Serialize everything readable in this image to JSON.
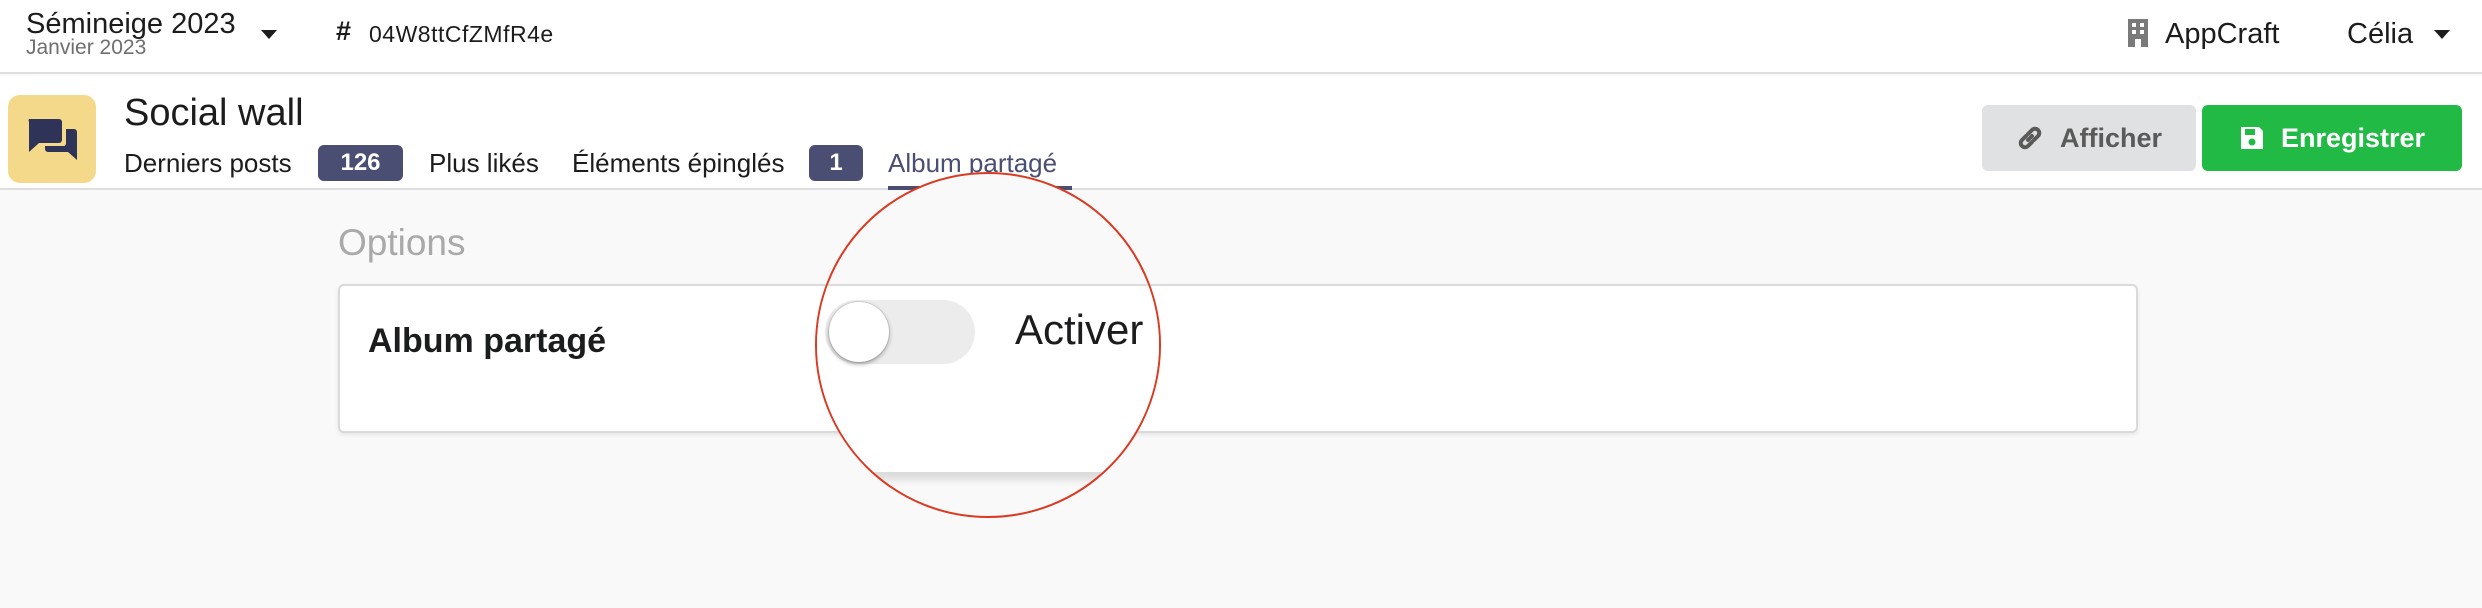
{
  "header": {
    "event_name": "Sémineige 2023",
    "event_subtitle": "Janvier 2023",
    "event_code": "04W8ttCfZMfR4e",
    "organization": "AppCraft",
    "user_name": "Célia"
  },
  "module": {
    "title": "Social wall",
    "icon": "chat-bubbles-icon",
    "icon_bg_color": "#f5d98b"
  },
  "tabs": [
    {
      "label": "Derniers posts",
      "badge": "126"
    },
    {
      "label": "Plus likés"
    },
    {
      "label": "Éléments épinglés",
      "badge": "1"
    },
    {
      "label": "Album partagé",
      "active": true
    }
  ],
  "actions": {
    "view_label": "Afficher",
    "save_label": "Enregistrer"
  },
  "options": {
    "section_title": "Options",
    "field_label": "Album partagé",
    "toggle_label": "Activer",
    "toggle_on": false
  },
  "colors": {
    "accent": "#4a4e72",
    "save": "#21ba45",
    "highlight_circle": "#db3a22"
  }
}
